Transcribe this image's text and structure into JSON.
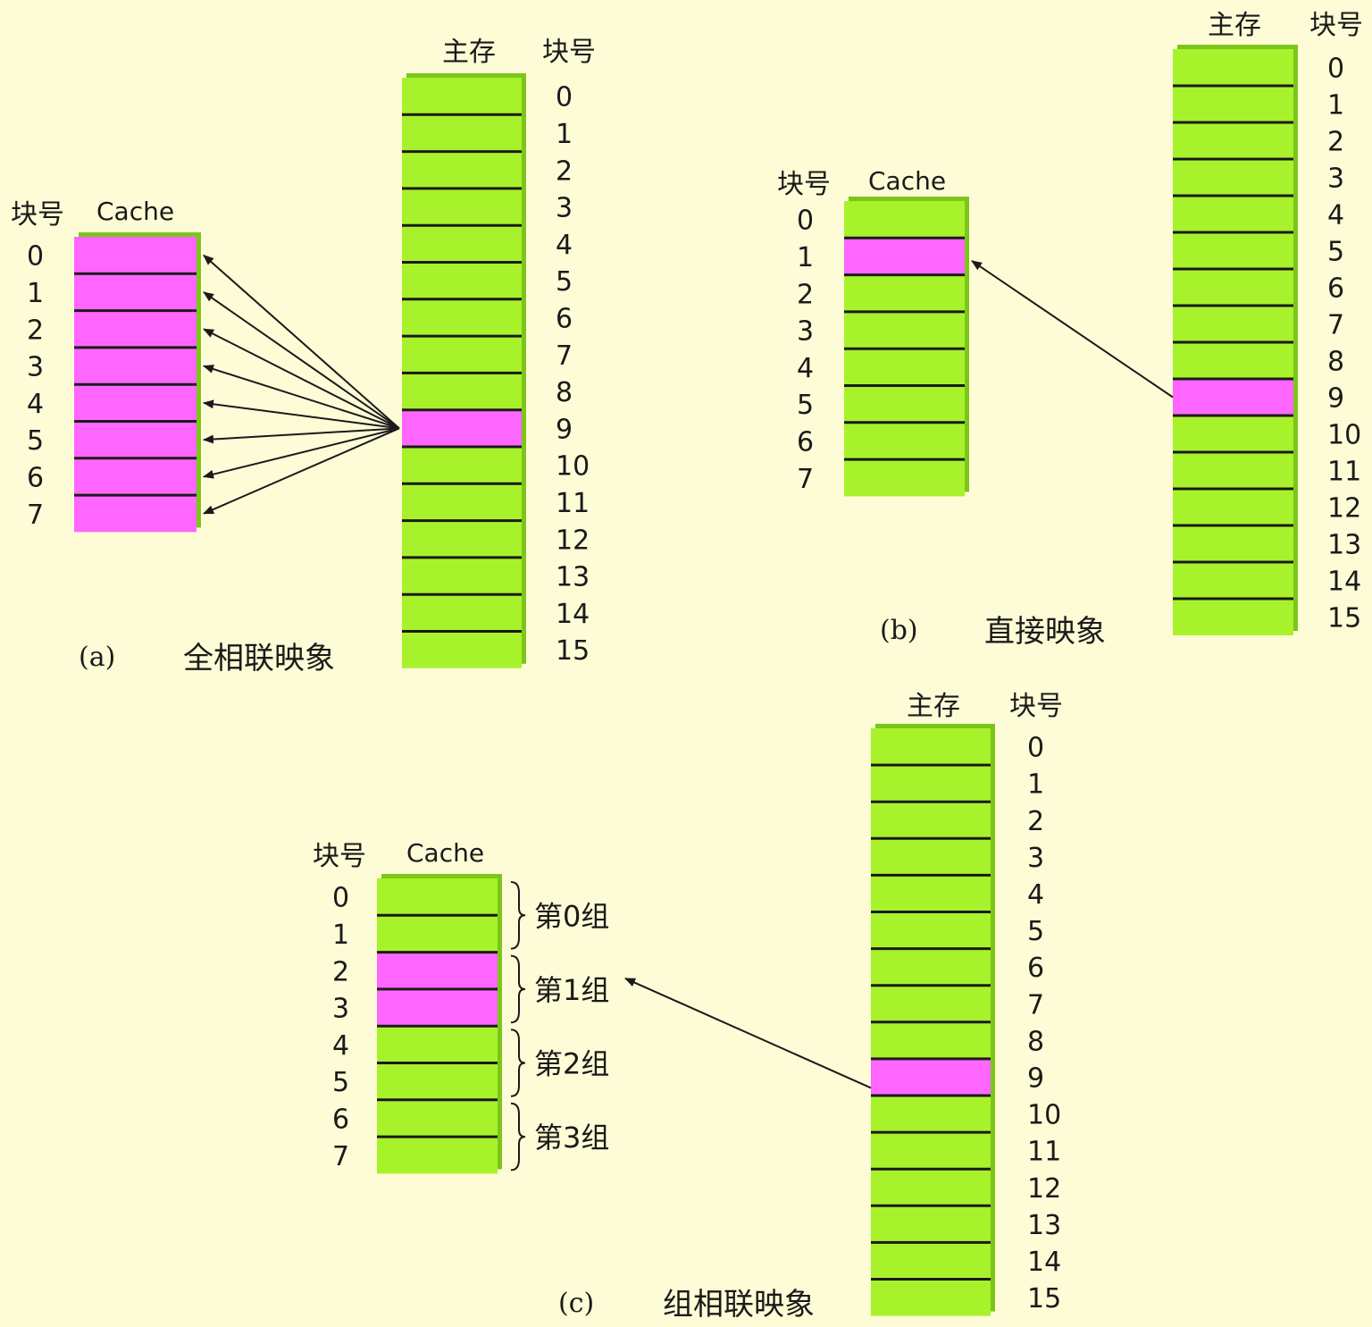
{
  "colors": {
    "background": "#fdfcd6",
    "block_green": "#a8f22c",
    "block_shadow": "#7cc61a",
    "highlight": "#ff66ff",
    "line": "#1a1a1a"
  },
  "labels": {
    "main_memory": "主存",
    "block_number": "块号",
    "cache": "Cache"
  },
  "memory_block_numbers": [
    "0",
    "1",
    "2",
    "3",
    "4",
    "5",
    "6",
    "7",
    "8",
    "9",
    "10",
    "11",
    "12",
    "13",
    "14",
    "15"
  ],
  "cache_block_numbers": [
    "0",
    "1",
    "2",
    "3",
    "4",
    "5",
    "6",
    "7"
  ],
  "panels": {
    "a": {
      "label": "(a)",
      "title": "全相联映象",
      "memory_highlight": [
        9
      ],
      "cache_highlight": [
        0,
        1,
        2,
        3,
        4,
        5,
        6,
        7
      ],
      "arrow_targets": [
        0,
        1,
        2,
        3,
        4,
        5,
        6,
        7
      ]
    },
    "b": {
      "label": "(b)",
      "title": "直接映象",
      "memory_highlight": [
        9
      ],
      "cache_highlight": [
        1
      ],
      "arrow_targets": [
        1
      ]
    },
    "c": {
      "label": "(c)",
      "title": "组相联映象",
      "memory_highlight": [
        9
      ],
      "cache_highlight": [
        2,
        3
      ],
      "groups": [
        "第0组",
        "第1组",
        "第2组",
        "第3组"
      ],
      "arrow_group": 1
    }
  }
}
